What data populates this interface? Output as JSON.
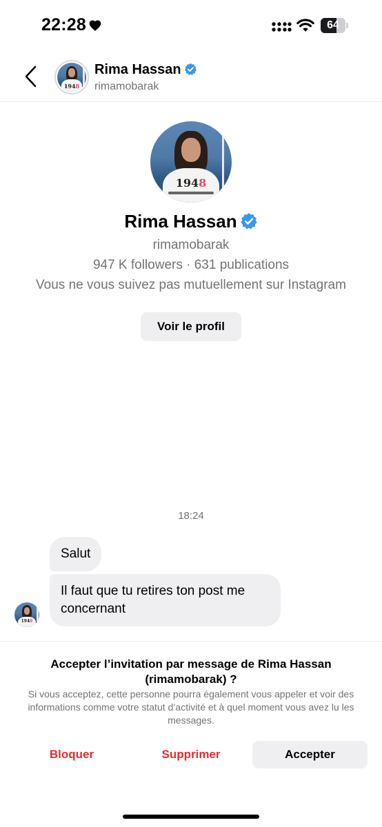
{
  "status_bar": {
    "time": "22:28",
    "battery_level": "64",
    "battery_fraction": 0.64,
    "icons": [
      "heart-icon",
      "cellular-signal-icon",
      "wifi-icon",
      "battery-icon"
    ]
  },
  "header": {
    "name": "Rima Hassan",
    "handle": "rimamobarak",
    "icons": [
      "back-chevron-icon",
      "verified-badge-icon"
    ]
  },
  "profile": {
    "name": "Rima Hassan",
    "handle": "rimamobarak",
    "stats": "947 K followers · 631 publications",
    "mutual": "Vous ne vous suivez pas mutuellement sur Instagram",
    "view_profile_label": "Voir le profil",
    "shirt_text_main": "194",
    "shirt_text_accent": "8"
  },
  "conversation": {
    "timestamp": "18:24",
    "messages": [
      {
        "text": "Salut"
      },
      {
        "text": "Il faut que tu retires ton post me concernant"
      }
    ]
  },
  "invitation": {
    "title": "Accepter l’invitation par message de Rima Hassan (rimamobarak) ?",
    "description": "Si vous acceptez, cette personne pourra également vous appeler et voir des informations comme votre statut d’activité et à quel moment vous avez lu les messages.",
    "block_label": "Bloquer",
    "delete_label": "Supprimer",
    "accept_label": "Accepter"
  },
  "colors": {
    "verified": "#3897f0",
    "danger": "#ed2a2a",
    "muted_text": "#737373",
    "bubble_bg": "#efeff1"
  }
}
